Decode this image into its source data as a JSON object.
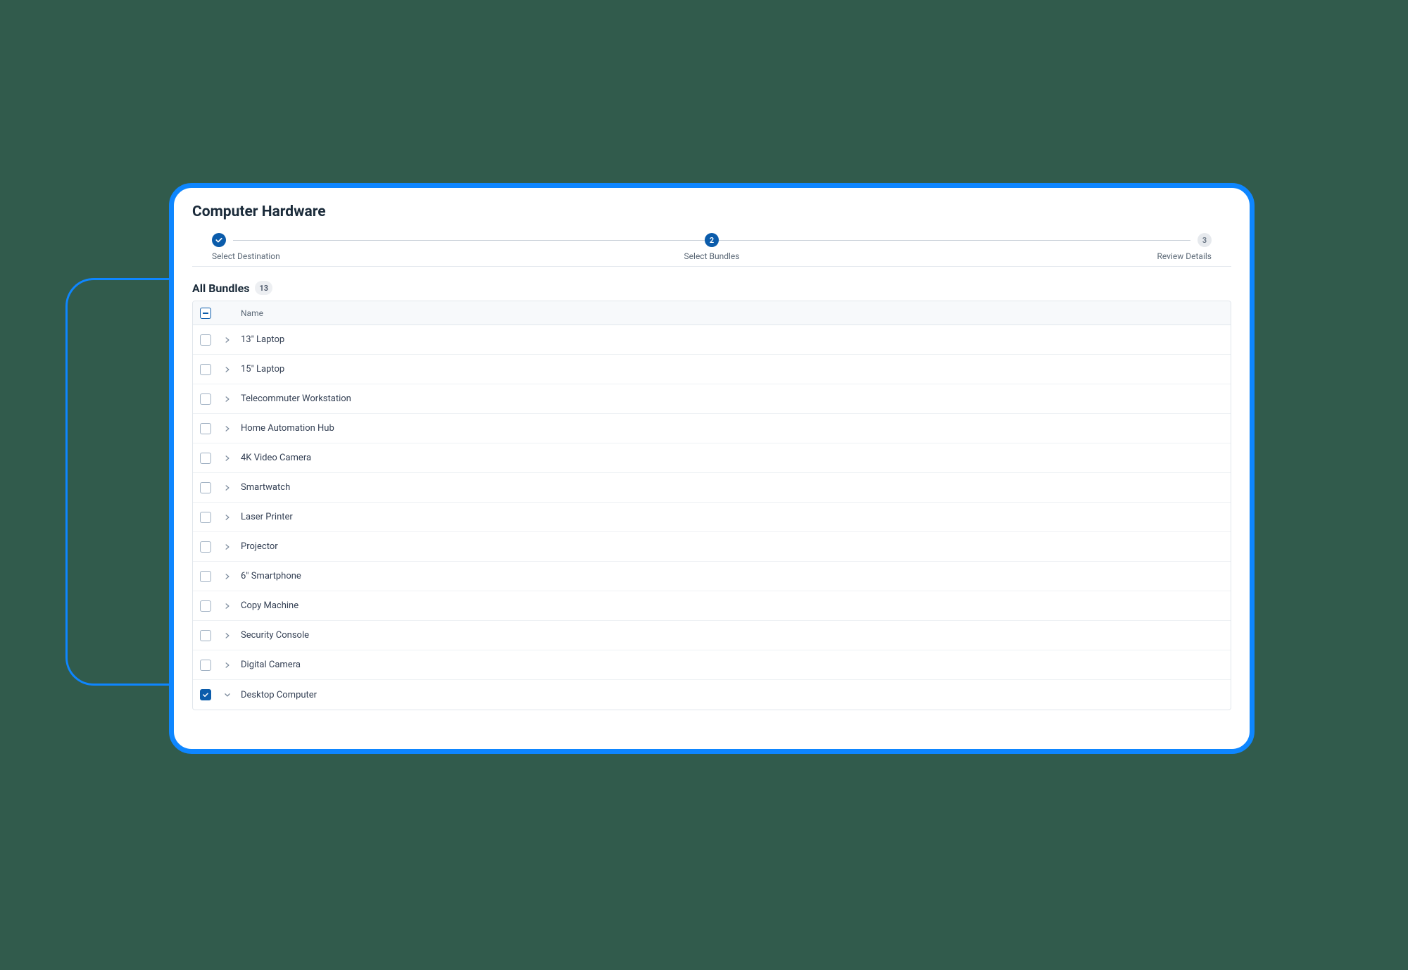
{
  "page_title": "Computer Hardware",
  "steps": [
    {
      "label": "Select Destination",
      "state": "done"
    },
    {
      "label": "Select Bundles",
      "state": "current",
      "num": "2"
    },
    {
      "label": "Review Details",
      "state": "todo",
      "num": "3"
    }
  ],
  "bundles_section_title": "All Bundles",
  "bundles_count": "13",
  "table": {
    "header_checkbox": "indeterminate",
    "columns": {
      "name": "Name"
    },
    "rows": [
      {
        "checked": false,
        "expanded": false,
        "name": "13\" Laptop"
      },
      {
        "checked": false,
        "expanded": false,
        "name": "15\" Laptop"
      },
      {
        "checked": false,
        "expanded": false,
        "name": "Telecommuter Workstation"
      },
      {
        "checked": false,
        "expanded": false,
        "name": "Home Automation Hub"
      },
      {
        "checked": false,
        "expanded": false,
        "name": "4K Video Camera"
      },
      {
        "checked": false,
        "expanded": false,
        "name": "Smartwatch"
      },
      {
        "checked": false,
        "expanded": false,
        "name": "Laser Printer"
      },
      {
        "checked": false,
        "expanded": false,
        "name": "Projector"
      },
      {
        "checked": false,
        "expanded": false,
        "name": "6\" Smartphone"
      },
      {
        "checked": false,
        "expanded": false,
        "name": "Copy Machine"
      },
      {
        "checked": false,
        "expanded": false,
        "name": "Security Console"
      },
      {
        "checked": false,
        "expanded": false,
        "name": "Digital Camera"
      },
      {
        "checked": true,
        "expanded": true,
        "name": "Desktop Computer"
      }
    ]
  },
  "colors": {
    "page_bg": "#315B4C",
    "accent_blue": "#0E86FF",
    "primary_dark_blue": "#0B5CAB"
  }
}
